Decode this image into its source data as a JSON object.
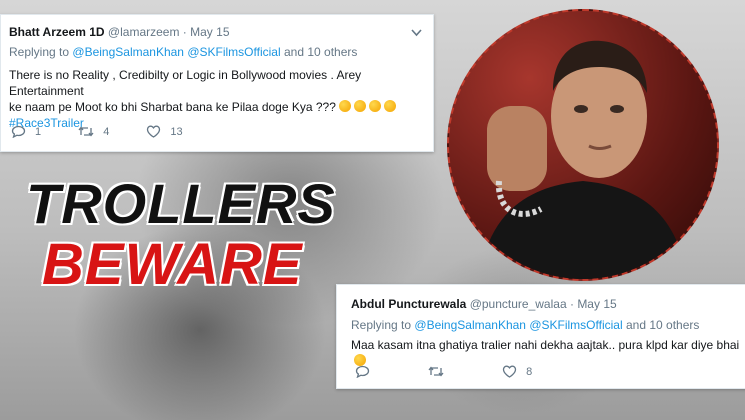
{
  "tweet1": {
    "name": "Bhatt Arzeem 1D",
    "handle": "@lamarzeem",
    "separator": "·",
    "date": "May 15",
    "replying_prefix": "Replying to",
    "reply_to": [
      "@BeingSalmanKhan",
      "@SKFilmsOfficial"
    ],
    "reply_suffix": "and 10 others",
    "text_line1": "There is no Reality , Credibilty or Logic in Bollywood movies . Arey Entertainment",
    "text_line2": "ke naam pe Moot ko bhi Sharbat bana ke Pilaa doge Kya ???",
    "hashtag": "#Race3Trailer",
    "reply_count": "1",
    "retweet_count": "4",
    "like_count": "13"
  },
  "tweet2": {
    "name": "Abdul Puncturewala",
    "handle": "@puncture_walaa",
    "separator": "·",
    "date": "May 15",
    "replying_prefix": "Replying to",
    "reply_to": [
      "@BeingSalmanKhan",
      "@SKFilmsOfficial"
    ],
    "reply_suffix": "and 10 others",
    "text": "Maa kasam itna ghatiya tralier nahi dekha aajtak.. pura klpd kar diye bhai",
    "reply_count": "",
    "retweet_count": "",
    "like_count": "8"
  },
  "headline": {
    "line1": "TROLLERS",
    "line2": "BEWARE"
  },
  "icons": {
    "reply": "reply-icon",
    "retweet": "retweet-icon",
    "like": "heart-icon",
    "more": "chevron-down-icon"
  },
  "colors": {
    "link": "#1b95e0",
    "muted": "#657786",
    "headline_red": "#d81414"
  }
}
